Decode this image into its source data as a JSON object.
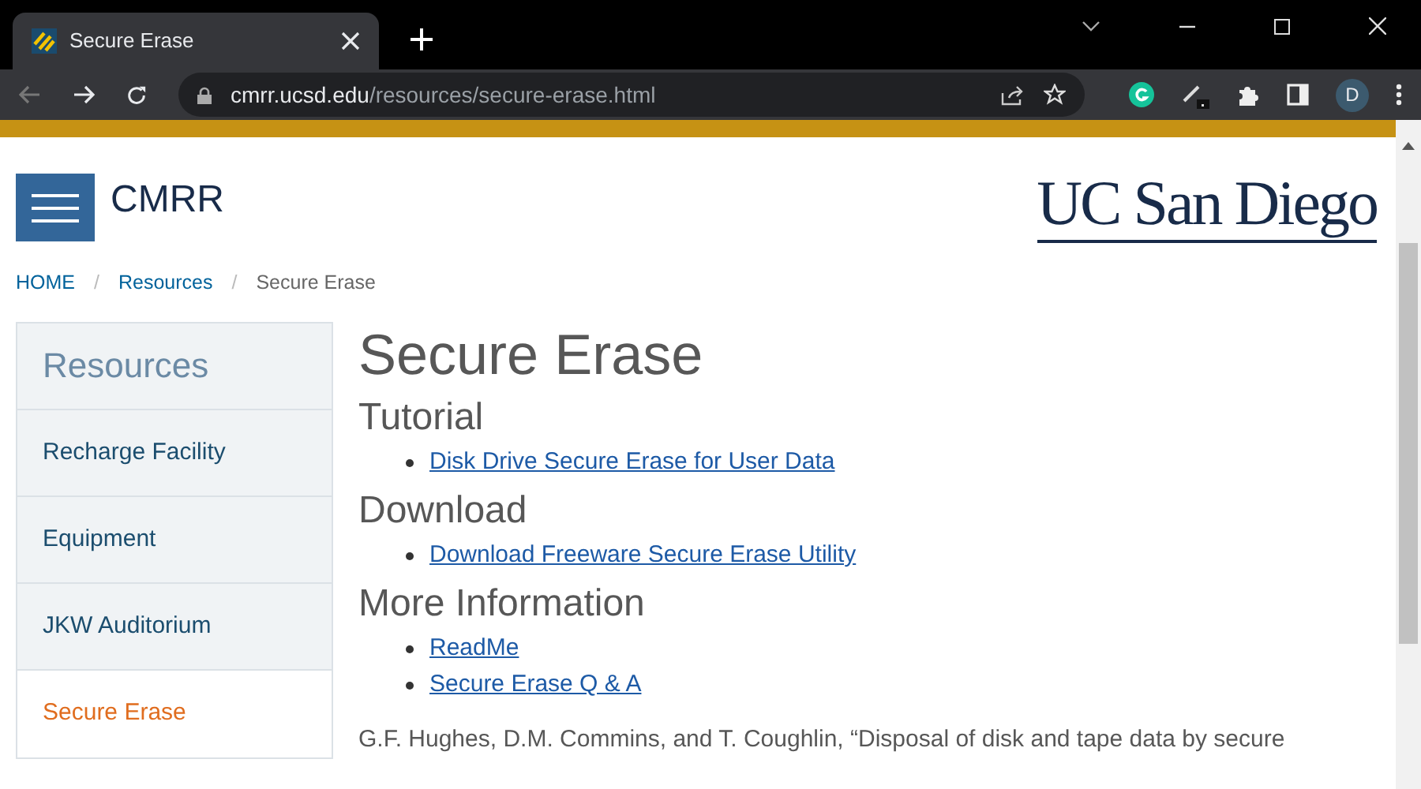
{
  "browser": {
    "tab": {
      "title": "Secure Erase",
      "selected": true
    },
    "url": {
      "host": "cmrr.ucsd.edu",
      "path": "/resources/secure-erase.html"
    },
    "profile": "D"
  },
  "header": {
    "site_name": "CMRR",
    "logo": "UC San Diego"
  },
  "breadcrumb": [
    {
      "label": "HOME",
      "kind": "link"
    },
    {
      "label": "/",
      "kind": "separator"
    },
    {
      "label": "Resources",
      "kind": "link"
    },
    {
      "label": "/",
      "kind": "separator"
    },
    {
      "label": "Secure Erase",
      "kind": "current"
    }
  ],
  "sidebar": {
    "title": "Resources",
    "items": [
      {
        "label": "Recharge Facility",
        "selected": false
      },
      {
        "label": "Equipment",
        "selected": false
      },
      {
        "label": "JKW Auditorium",
        "selected": false
      },
      {
        "label": "Secure Erase",
        "selected": true
      }
    ]
  },
  "main": {
    "title": "Secure Erase",
    "sections": [
      {
        "heading": "Tutorial",
        "links": [
          "Disk Drive Secure Erase for User Data"
        ]
      },
      {
        "heading": "Download",
        "links": [
          "Download Freeware Secure Erase Utility"
        ]
      },
      {
        "heading": "More Information",
        "links": [
          "ReadMe",
          "Secure Erase Q & A"
        ]
      }
    ],
    "citation": "G.F. Hughes, D.M. Commins, and T. Coughlin, “Disposal of disk and tape data by secure"
  }
}
